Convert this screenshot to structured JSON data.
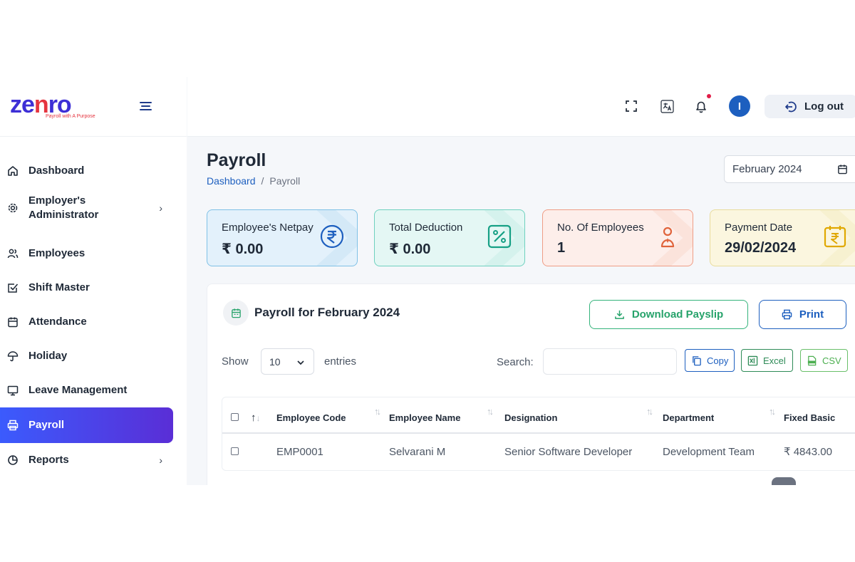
{
  "brand": {
    "name_part1": "ze",
    "name_part2": "n",
    "name_part3": "ro",
    "tagline": "Payroll with A Purpose"
  },
  "sidebar": {
    "items": [
      {
        "label": "Dashboard",
        "icon": "home-icon"
      },
      {
        "label": "Employer's Administrator",
        "icon": "gear-icon",
        "has_submenu": true
      },
      {
        "label": "Employees",
        "icon": "users-icon"
      },
      {
        "label": "Shift Master",
        "icon": "checkbox-icon"
      },
      {
        "label": "Attendance",
        "icon": "calendar-icon"
      },
      {
        "label": "Holiday",
        "icon": "umbrella-icon"
      },
      {
        "label": "Leave Management",
        "icon": "monitor-icon"
      },
      {
        "label": "Payroll",
        "icon": "printer-icon",
        "active": true
      },
      {
        "label": "Reports",
        "icon": "pie-chart-icon",
        "has_submenu": true
      }
    ]
  },
  "header": {
    "avatar_initial": "I",
    "logout_label": "Log out"
  },
  "page": {
    "title": "Payroll",
    "breadcrumb": {
      "root": "Dashboard",
      "current": "Payroll",
      "separator": "/"
    },
    "month": "February 2024"
  },
  "cards": [
    {
      "title": "Employee's Netpay",
      "value": "₹ 0.00",
      "icon": "rupee-icon"
    },
    {
      "title": "Total Deduction",
      "value": "₹ 0.00",
      "icon": "percent-icon"
    },
    {
      "title": "No. Of Employees",
      "value": "1",
      "icon": "person-icon"
    },
    {
      "title": "Payment Date",
      "value": "29/02/2024",
      "icon": "calendar-rupee-icon"
    }
  ],
  "panel": {
    "title": "Payroll for February 2024",
    "download_label": "Download Payslip",
    "print_label": "Print",
    "show_label": "Show",
    "entries_value": "10",
    "entries_label": "entries",
    "search_label": "Search:",
    "search_value": "",
    "tools": {
      "copy": "Copy",
      "excel": "Excel",
      "csv": "CSV"
    }
  },
  "table": {
    "columns": [
      "Employee Code",
      "Employee Name",
      "Designation",
      "Department",
      "Fixed Basic"
    ],
    "rows": [
      [
        "EMP0001",
        "Selvarani M",
        "Senior Software Developer",
        "Development Team",
        "₹ 4843.00"
      ]
    ]
  },
  "colors": {
    "accent_blue": "#1d5fbf",
    "active_gradient_start": "#3b5bfd",
    "active_gradient_end": "#5a2ed6",
    "card_netpay": "#e3f1fb",
    "card_deduction": "#e4f7f4",
    "card_employees": "#fdeeea",
    "card_payment": "#fbf6df"
  }
}
